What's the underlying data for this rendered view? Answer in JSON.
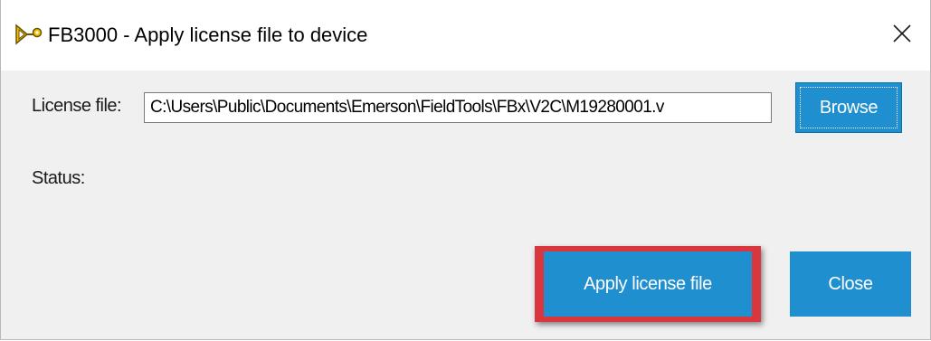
{
  "window": {
    "title": "FB3000 - Apply license file to device",
    "icon": "key-icon",
    "close_glyph": "✕"
  },
  "form": {
    "license_label": "License file:",
    "license_value": "C:\\Users\\Public\\Documents\\Emerson\\FieldTools\\FBx\\V2C\\M19280001.v",
    "browse_label": "Browse",
    "status_label": "Status:",
    "status_value": ""
  },
  "actions": {
    "apply_label": "Apply license file",
    "close_label": "Close"
  },
  "colors": {
    "button_blue": "#1f8fd0",
    "highlight_red": "#d9363e",
    "window_bg": "#f0f0f0",
    "titlebar_bg": "#ffffff"
  }
}
